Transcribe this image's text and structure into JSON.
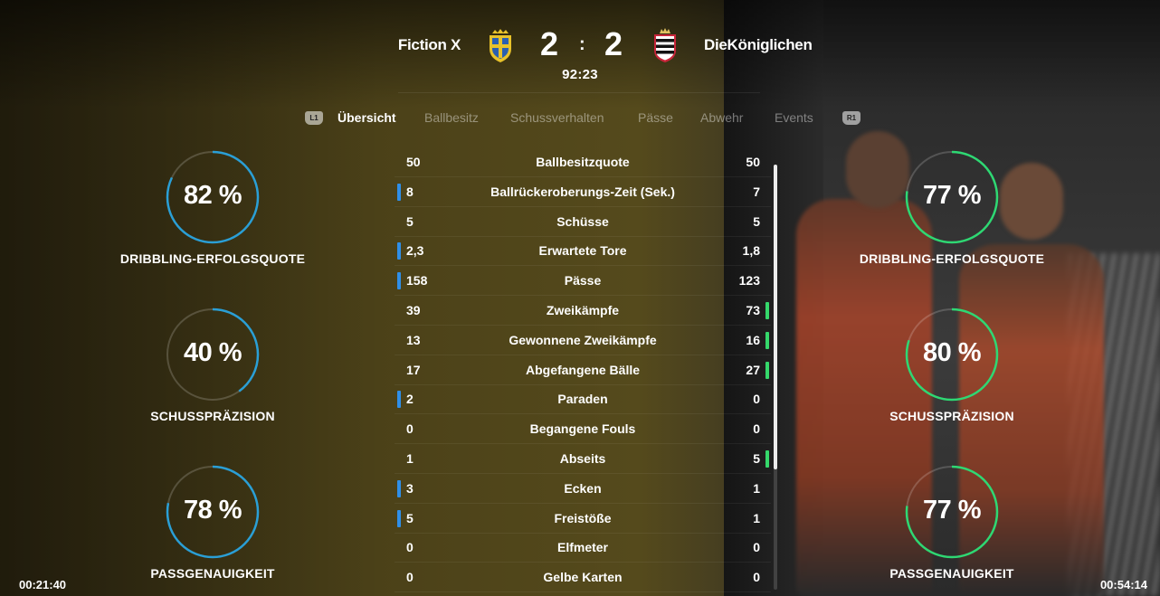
{
  "match": {
    "home_team": "Fiction X",
    "away_team": "DieKöniglichen",
    "home_score": "2",
    "away_score": "2",
    "separator": ":",
    "clock": "92:23"
  },
  "tabs": {
    "left_bumper": "L1",
    "right_bumper": "R1",
    "items": [
      "Übersicht",
      "Ballbesitz",
      "Schussverhalten",
      "Pässe",
      "Abwehr",
      "Events"
    ],
    "active": "Übersicht"
  },
  "home_rings": [
    {
      "value": "82 %",
      "label": "DRIBBLING-ERFOLGSQUOTE",
      "fraction": 0.82
    },
    {
      "value": "40 %",
      "label": "SCHUSSPRÄZISION",
      "fraction": 0.4
    },
    {
      "value": "78 %",
      "label": "PASSGENAUIGKEIT",
      "fraction": 0.78
    }
  ],
  "away_rings": [
    {
      "value": "77 %",
      "label": "DRIBBLING-ERFOLGSQUOTE",
      "fraction": 0.77
    },
    {
      "value": "80 %",
      "label": "SCHUSSPRÄZISION",
      "fraction": 0.8
    },
    {
      "value": "77 %",
      "label": "PASSGENAUIGKEIT",
      "fraction": 0.77
    }
  ],
  "stats": [
    {
      "name": "Ballbesitzquote",
      "home": "50",
      "away": "50",
      "leader": "none"
    },
    {
      "name": "Ballrückeroberungs-Zeit (Sek.)",
      "home": "8",
      "away": "7",
      "leader": "home"
    },
    {
      "name": "Schüsse",
      "home": "5",
      "away": "5",
      "leader": "none"
    },
    {
      "name": "Erwartete Tore",
      "home": "2,3",
      "away": "1,8",
      "leader": "home"
    },
    {
      "name": "Pässe",
      "home": "158",
      "away": "123",
      "leader": "home"
    },
    {
      "name": "Zweikämpfe",
      "home": "39",
      "away": "73",
      "leader": "away"
    },
    {
      "name": "Gewonnene Zweikämpfe",
      "home": "13",
      "away": "16",
      "leader": "away"
    },
    {
      "name": "Abgefangene Bälle",
      "home": "17",
      "away": "27",
      "leader": "away"
    },
    {
      "name": "Paraden",
      "home": "2",
      "away": "0",
      "leader": "home"
    },
    {
      "name": "Begangene Fouls",
      "home": "0",
      "away": "0",
      "leader": "none"
    },
    {
      "name": "Abseits",
      "home": "1",
      "away": "5",
      "leader": "away"
    },
    {
      "name": "Ecken",
      "home": "3",
      "away": "1",
      "leader": "home"
    },
    {
      "name": "Freistöße",
      "home": "5",
      "away": "1",
      "leader": "home"
    },
    {
      "name": "Elfmeter",
      "home": "0",
      "away": "0",
      "leader": "none"
    },
    {
      "name": "Gelbe Karten",
      "home": "0",
      "away": "0",
      "leader": "none"
    }
  ],
  "video": {
    "elapsed": "00:21:40",
    "remaining": "00:54:14"
  },
  "colors": {
    "home_ring": "#2a9fd6",
    "away_ring": "#2ed873",
    "home_bar": "#2f8fe8",
    "away_bar": "#35d86b"
  }
}
